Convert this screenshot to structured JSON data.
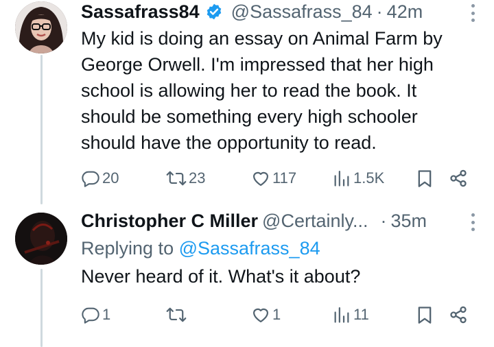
{
  "tweets": [
    {
      "name": "Sassafrass84",
      "verified": true,
      "handle": "@Sassafrass_84",
      "dot": "·",
      "time": "42m",
      "text": "My kid is doing an essay on Animal Farm by George Orwell. I'm impressed that her high school is allowing her to read the book. It should be something every high schooler should have the opportunity to read.",
      "stats": {
        "replies": "20",
        "retweets": "23",
        "likes": "117",
        "views": "1.5K"
      }
    },
    {
      "name": "Christopher C Miller",
      "verified": false,
      "handle": "@Certainly...",
      "dot": "·",
      "time": "35m",
      "replying_prefix": "Replying to ",
      "replying_to": "@Sassafrass_84",
      "text": "Never heard of it. What's it about?",
      "stats": {
        "replies": "1",
        "retweets": "",
        "likes": "1",
        "views": "11"
      }
    }
  ],
  "colors": {
    "accent": "#1d9bf0",
    "muted": "#536471",
    "text": "#0f1419",
    "thread": "#cfd9de"
  }
}
